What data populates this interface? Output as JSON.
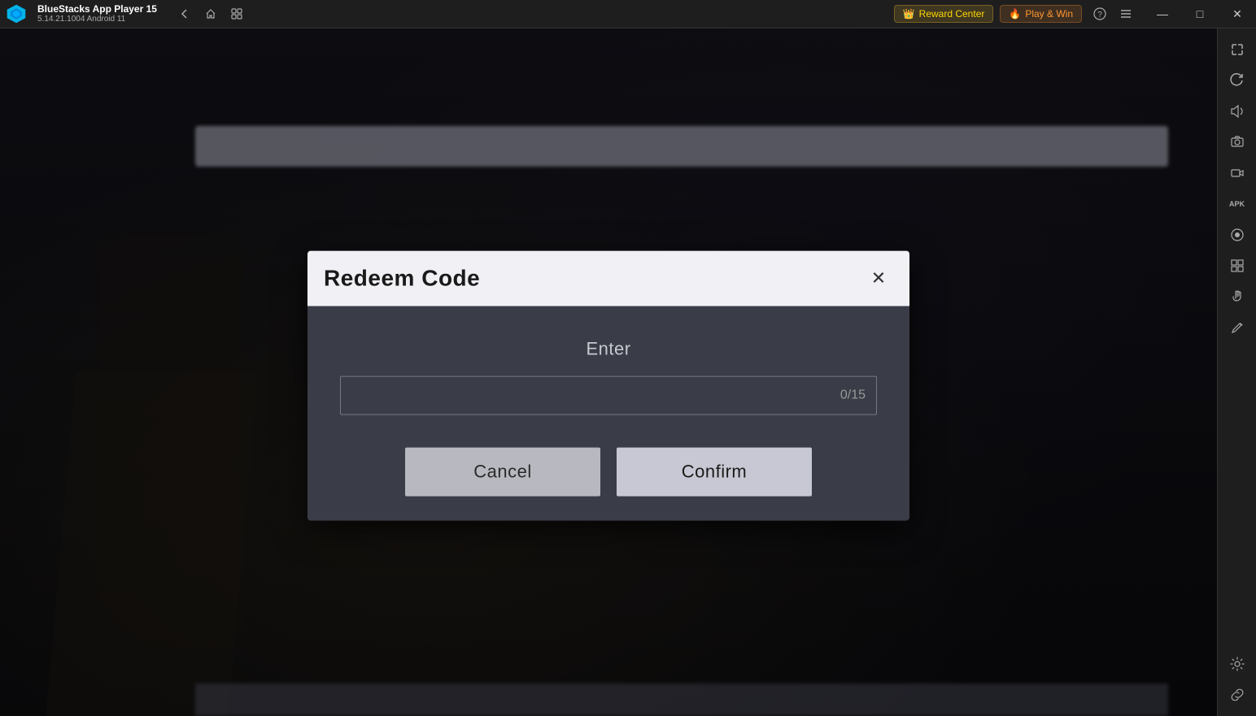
{
  "titlebar": {
    "app_name": "BlueStacks App Player 15",
    "version": "5.14.21.1004  Android 11",
    "reward_center_label": "Reward Center",
    "play_win_label": "Play & Win"
  },
  "window_controls": {
    "minimize_label": "—",
    "maximize_label": "□",
    "close_label": "✕"
  },
  "modal": {
    "title": "Redeem Code",
    "close_icon": "✕",
    "body_label": "Enter",
    "input_placeholder": "",
    "input_counter": "0/15",
    "cancel_label": "Cancel",
    "confirm_label": "Confirm"
  },
  "sidebar_icons": [
    {
      "name": "expand-icon",
      "symbol": "⤢"
    },
    {
      "name": "rotate-icon",
      "symbol": "↻"
    },
    {
      "name": "volume-icon",
      "symbol": "♪"
    },
    {
      "name": "screenshot-icon",
      "symbol": "📷"
    },
    {
      "name": "camera-icon",
      "symbol": "◎"
    },
    {
      "name": "apk-icon",
      "symbol": "APK"
    },
    {
      "name": "record-icon",
      "symbol": "⏺"
    },
    {
      "name": "resize-icon",
      "symbol": "⊞"
    },
    {
      "name": "hand-icon",
      "symbol": "✋"
    },
    {
      "name": "edit-icon",
      "symbol": "✎"
    },
    {
      "name": "settings-icon",
      "symbol": "⚙"
    },
    {
      "name": "download-icon",
      "symbol": "⬇"
    }
  ]
}
